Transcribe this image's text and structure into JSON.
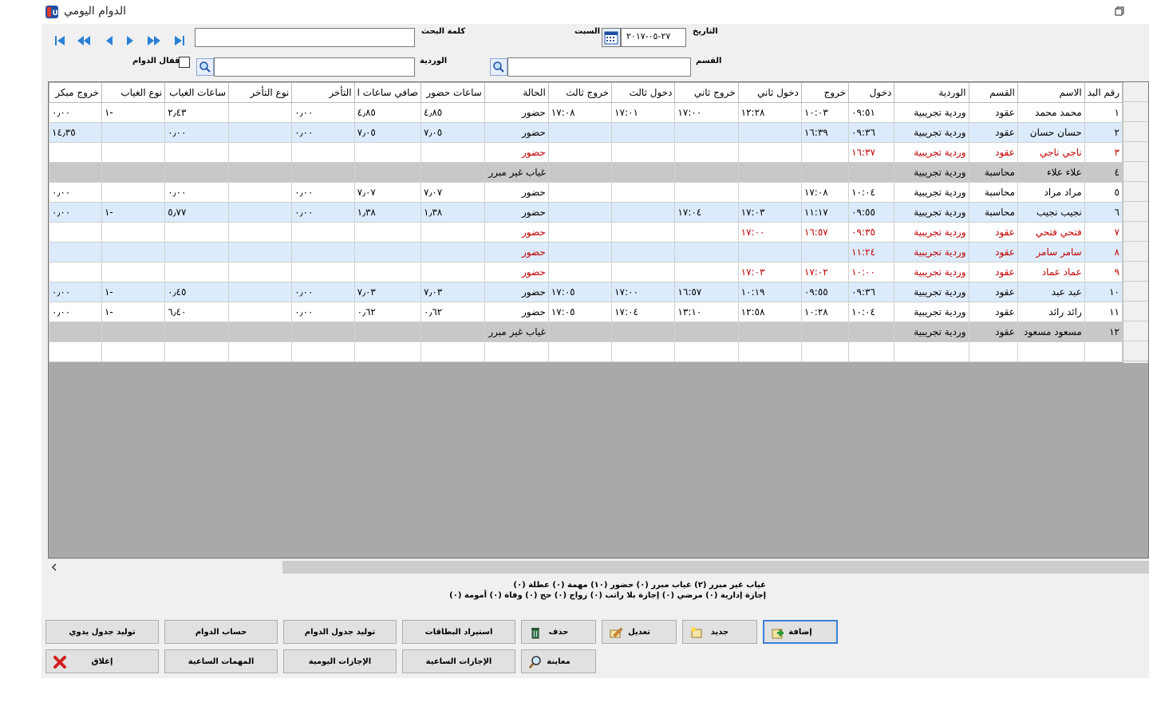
{
  "window": {
    "title": "الدوام اليومي"
  },
  "filters": {
    "date_label": "التاريخ",
    "date_value": "٢٧-٠٥-٢٠١٧",
    "day_name": "السبت",
    "search_label": "كلمة البحث",
    "search_value": "",
    "department_label": "القسم",
    "department_value": "",
    "shift_label": "الوردية",
    "shift_value": "",
    "lock_label": "إقفال الدوام",
    "lock_checked": false
  },
  "grid": {
    "columns": [
      "رقم البد",
      "الاسم",
      "القسم",
      "الوردية",
      "دخول",
      "خروج",
      "دخول ثاني",
      "خروج ثاني",
      "دخول ثالث",
      "خروج ثالث",
      "الحالة",
      "ساعات حضور",
      "صافي ساعات ا",
      "التأخر",
      "نوع التأخر",
      "ساعات الغياب",
      "نوع الغياب",
      "خروج مبكر"
    ],
    "rows": [
      {
        "style": "",
        "cells": [
          "١",
          "محمد محمد",
          "عقود",
          "وردية تجريبية",
          "٠٩:٥١",
          "١٠:٠٣",
          "١٢:٢٨",
          "١٧:٠٠",
          "١٧:٠١",
          "١٧:٠٨",
          "حضور",
          "٤٫٨٥",
          "٤٫٨٥",
          "٠٫٠٠",
          "",
          "٢٫٤٣",
          "١-",
          "٠٫٠٠"
        ]
      },
      {
        "style": "alt",
        "cells": [
          "٢",
          "حسان حسان",
          "عقود",
          "وردية تجريبية",
          "٠٩:٣٦",
          "١٦:٣٩",
          "",
          "",
          "",
          "",
          "حضور",
          "٧٫٠٥",
          "٧٫٠٥",
          "٠٫٠٠",
          "",
          "٠٫٠٠",
          "",
          "١٤٫٣٥"
        ]
      },
      {
        "style": "red",
        "cells": [
          "٣",
          "ناجي ناجي",
          "عقود",
          "وردية تجريبية",
          "١٦:٣٧",
          "",
          "",
          "",
          "",
          "",
          "حضور",
          "",
          "",
          "",
          "",
          "",
          "",
          ""
        ]
      },
      {
        "style": "gray",
        "cells": [
          "٤",
          "علاء علاء",
          "محاسبة",
          "وردية تجريبية",
          "",
          "",
          "",
          "",
          "",
          "",
          "غياب غير مبرر",
          "",
          "",
          "",
          "",
          "",
          "",
          ""
        ]
      },
      {
        "style": "",
        "cells": [
          "٥",
          "مراد مراد",
          "محاسبة",
          "وردية تجريبية",
          "١٠:٠٤",
          "١٧:٠٨",
          "",
          "",
          "",
          "",
          "حضور",
          "٧٫٠٧",
          "٧٫٠٧",
          "٠٫٠٠",
          "",
          "٠٫٠٠",
          "",
          "٠٫٠٠"
        ]
      },
      {
        "style": "alt",
        "cells": [
          "٦",
          "نجيب نجيب",
          "محاسبة",
          "وردية تجريبية",
          "٠٩:٥٥",
          "١١:١٧",
          "١٧:٠٣",
          "١٧:٠٤",
          "",
          "",
          "حضور",
          "١٫٣٨",
          "١٫٣٨",
          "٠٫٠٠",
          "",
          "٥٫٧٧",
          "١-",
          "٠٫٠٠"
        ]
      },
      {
        "style": "red",
        "cells": [
          "٧",
          "فتحي فتحي",
          "عقود",
          "وردية تجريبية",
          "٠٩:٣٥",
          "١٦:٥٧",
          "١٧:٠٠",
          "",
          "",
          "",
          "حضور",
          "",
          "",
          "",
          "",
          "",
          "",
          ""
        ]
      },
      {
        "style": "alt red",
        "cells": [
          "٨",
          "سامر سامر",
          "عقود",
          "وردية تجريبية",
          "١١:٢٤",
          "",
          "",
          "",
          "",
          "",
          "حضور",
          "",
          "",
          "",
          "",
          "",
          "",
          ""
        ]
      },
      {
        "style": "red",
        "cells": [
          "٩",
          "عماد عماد",
          "عقود",
          "وردية تجريبية",
          "١٠:٠٠",
          "١٧:٠٢",
          "١٧:٠٣",
          "",
          "",
          "",
          "حضور",
          "",
          "",
          "",
          "",
          "",
          "",
          ""
        ]
      },
      {
        "style": "alt",
        "cells": [
          "١٠",
          "عبد عبد",
          "عقود",
          "وردية تجريبية",
          "٠٩:٣٦",
          "٠٩:٥٥",
          "١٠:١٩",
          "١٦:٥٧",
          "١٧:٠٠",
          "١٧:٠٥",
          "حضور",
          "٧٫٠٣",
          "٧٫٠٣",
          "٠٫٠٠",
          "",
          "٠٫٤٥",
          "١-",
          "٠٫٠٠"
        ]
      },
      {
        "style": "",
        "cells": [
          "١١",
          "رائد رائد",
          "عقود",
          "وردية تجريبية",
          "١٠:٠٤",
          "١٠:٢٨",
          "١٢:٥٨",
          "١٣:١٠",
          "١٧:٠٤",
          "١٧:٠٥",
          "حضور",
          "٠٫٦٢",
          "٠٫٦٢",
          "٠٫٠٠",
          "",
          "٦٫٤٠",
          "١-",
          "٠٫٠٠"
        ]
      },
      {
        "style": "gray",
        "cells": [
          "١٢",
          "مسعود مسعود",
          "عقود",
          "وردية تجريبية",
          "",
          "",
          "",
          "",
          "",
          "",
          "غياب غير مبرر",
          "",
          "",
          "",
          "",
          "",
          "",
          ""
        ]
      },
      {
        "style": "empty",
        "cells": [
          "",
          "",
          "",
          "",
          "",
          "",
          "",
          "",
          "",
          "",
          "",
          "",
          "",
          "",
          "",
          "",
          "",
          ""
        ]
      }
    ]
  },
  "summary": {
    "line1": "غياب غير مبرر (٢)   غياب مبرر (٠)   حضور (١٠)   مهمة (٠)   عطلة (٠)",
    "line2": "إجازة إدارية (٠)   مرضي (٠)   إجازة بلا راتب (٠)   زواج (٠)   حج (٠)   وفاة (٠)   أمومة (٠)"
  },
  "buttons": {
    "add": "إضافة",
    "new": "جديد",
    "edit": "تعديل",
    "delete": "حذف",
    "import_cards": "استيراد البطاقات",
    "generate_schedule": "توليد جدول الدوام",
    "calc_attendance": "حساب الدوام",
    "generate_manual": "توليد جدول يدوي",
    "preview": "معاينة",
    "hourly_leaves": "الإجازات الساعية",
    "daily_leaves": "الإجازات اليومية",
    "hourly_tasks": "المهمات الساعية",
    "close": "إغلاق"
  },
  "colors": {
    "alt_row": "#dcebfb",
    "gray_row": "#c8c8c8",
    "red_text": "#c00000",
    "grid_bg": "#a9a9a9"
  }
}
